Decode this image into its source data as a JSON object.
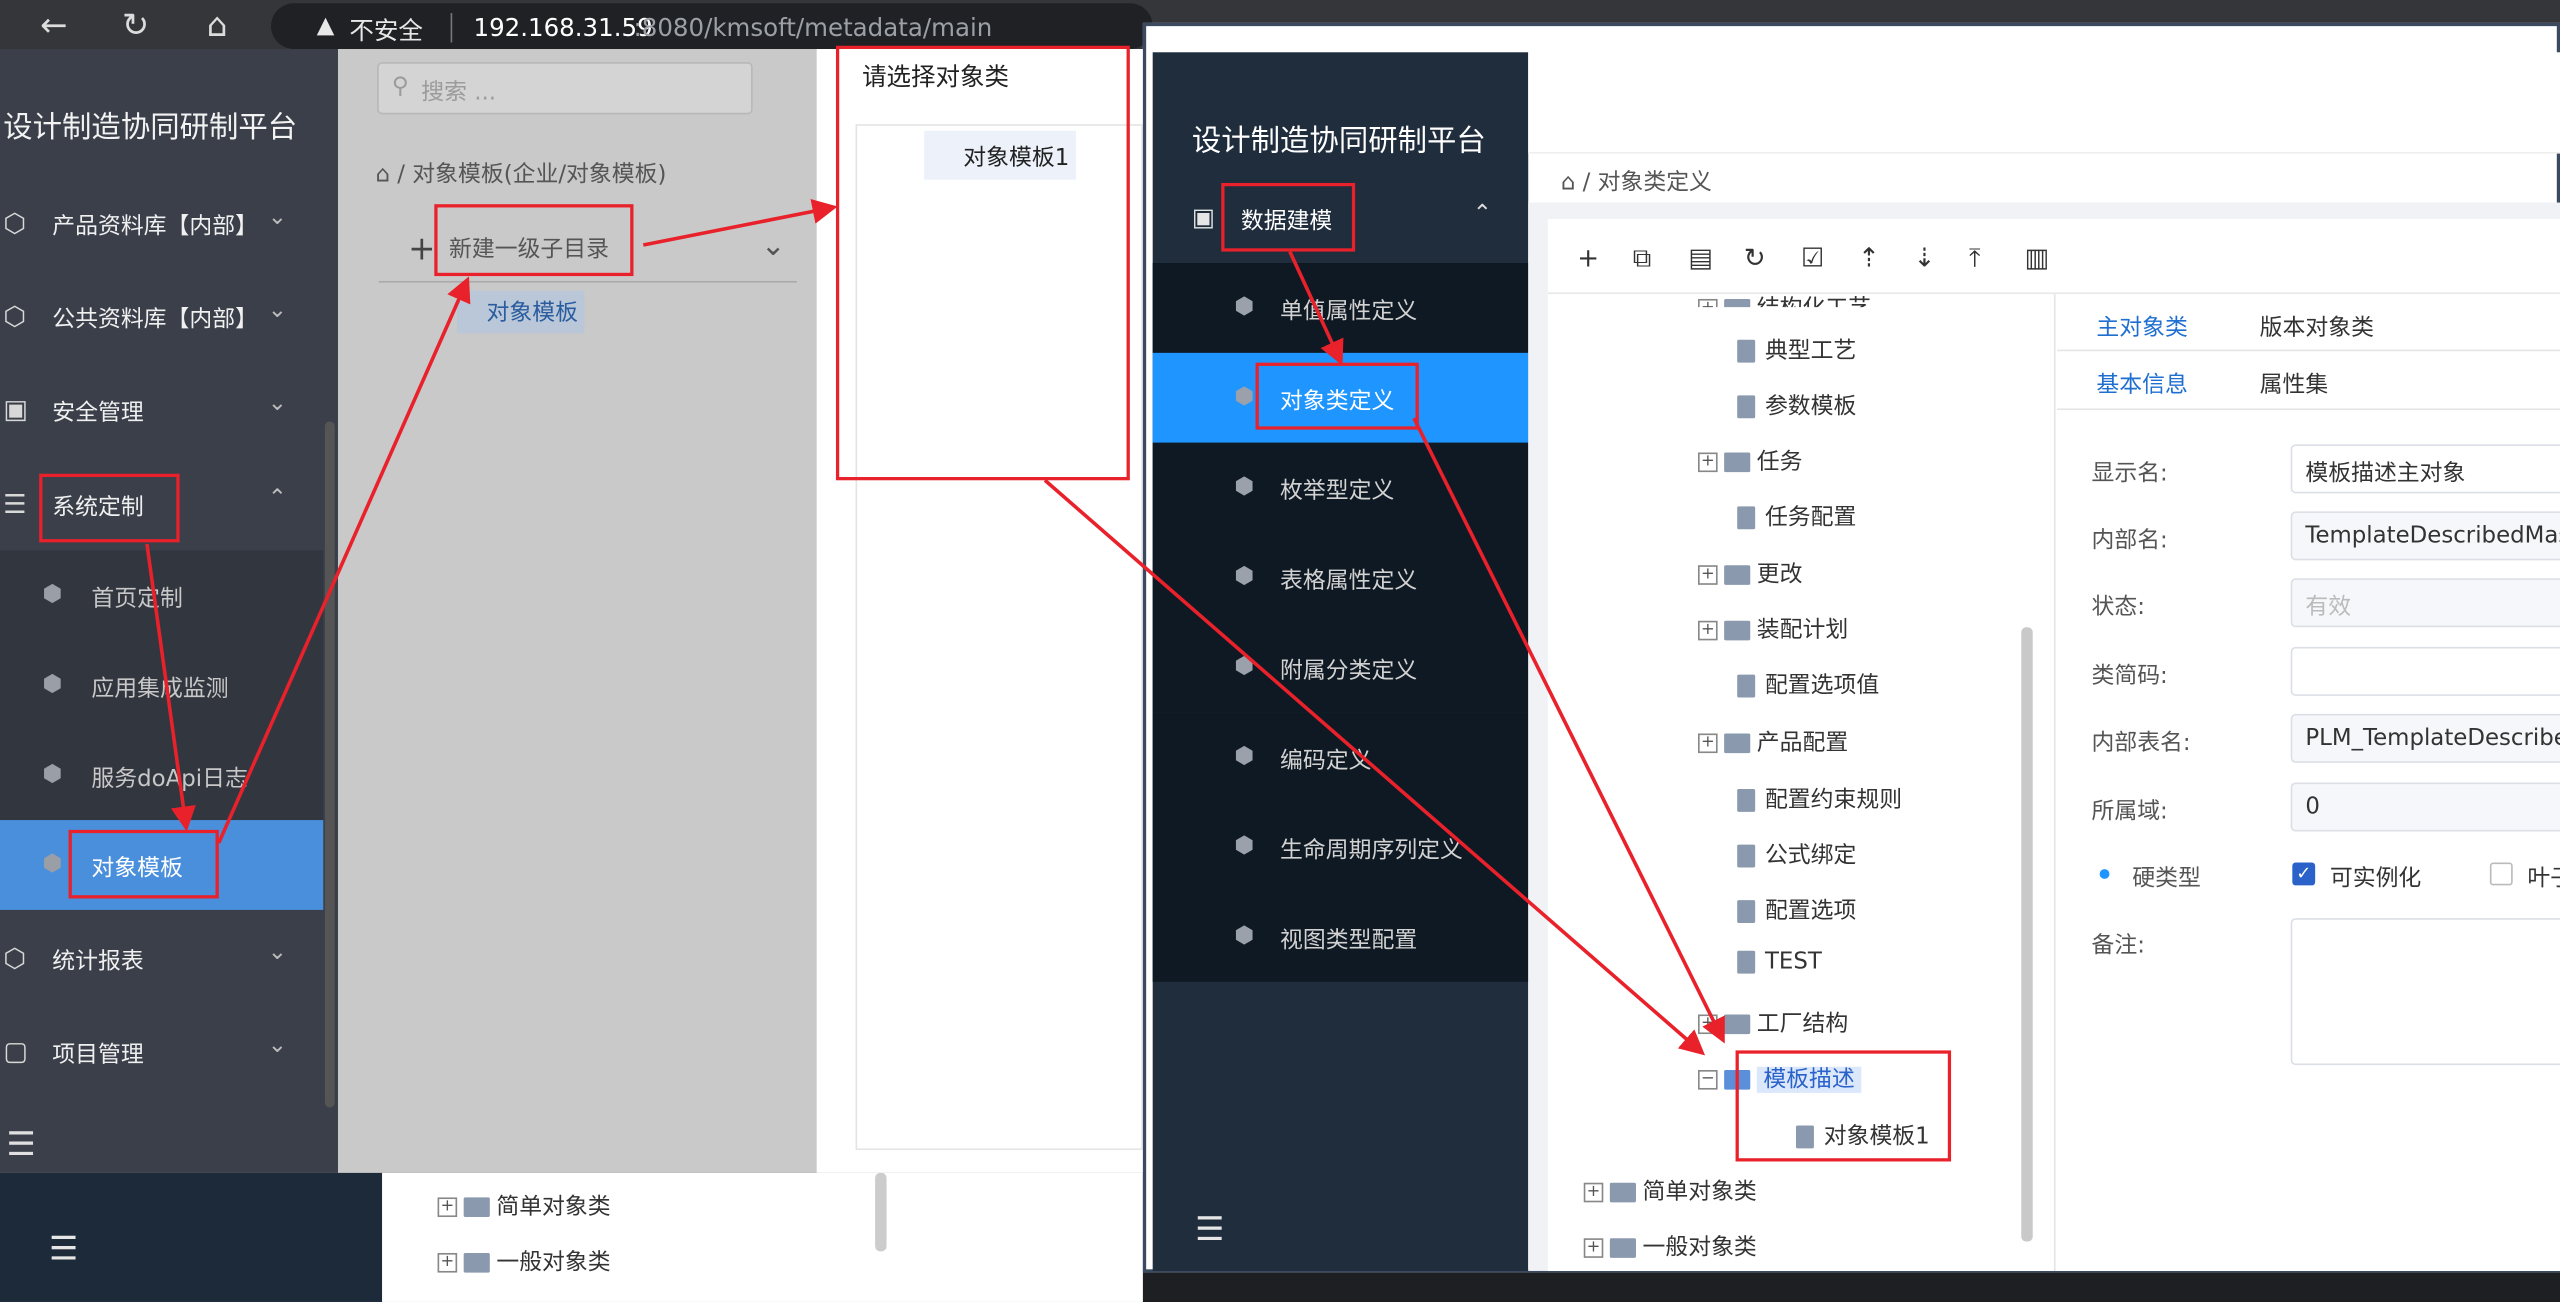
{
  "browser": {
    "warning": "不安全",
    "url_host": "192.168.31.59",
    "url_path": ":8080/kmsoft/metadata/main"
  },
  "left_app": {
    "brand": "设计制造协同研制平台",
    "menus": [
      {
        "label": "产品资料库【内部】"
      },
      {
        "label": "公共资料库【内部】"
      },
      {
        "label": "安全管理"
      },
      {
        "label": "系统定制"
      }
    ],
    "submenus": [
      {
        "label": "首页定制"
      },
      {
        "label": "应用集成监测"
      },
      {
        "label": "服务doApi日志"
      },
      {
        "label": "对象模板"
      }
    ],
    "menus_after": [
      {
        "label": "统计报表"
      },
      {
        "label": "项目管理"
      }
    ]
  },
  "middle": {
    "search_placeholder": "搜索 ...",
    "breadcrumb": "对象模板(企业/对象模板)",
    "new_dir": "新建一级子目录",
    "tree_item": "对象模板"
  },
  "picker": {
    "title": "请选择对象类",
    "node": "对象模板1"
  },
  "lower_tree": [
    {
      "label": "简单对象类"
    },
    {
      "label": "一般对象类"
    }
  ],
  "right_app": {
    "brand": "设计制造协同研制平台",
    "group": "数据建模",
    "items": [
      {
        "label": "单值属性定义"
      },
      {
        "label": "对象类定义"
      },
      {
        "label": "枚举型定义"
      },
      {
        "label": "表格属性定义"
      },
      {
        "label": "附属分类定义"
      },
      {
        "label": "编码定义"
      },
      {
        "label": "生命周期序列定义"
      },
      {
        "label": "视图类型配置"
      }
    ],
    "breadcrumb": "对象类定义",
    "tree": [
      {
        "label": "结构化工艺",
        "kind": "folder"
      },
      {
        "label": "典型工艺",
        "kind": "doc"
      },
      {
        "label": "参数模板",
        "kind": "doc"
      },
      {
        "label": "任务",
        "kind": "folder"
      },
      {
        "label": "任务配置",
        "kind": "doc"
      },
      {
        "label": "更改",
        "kind": "folder"
      },
      {
        "label": "装配计划",
        "kind": "folder"
      },
      {
        "label": "配置选项值",
        "kind": "doc"
      },
      {
        "label": "产品配置",
        "kind": "folder"
      },
      {
        "label": "配置约束规则",
        "kind": "doc"
      },
      {
        "label": "公式绑定",
        "kind": "doc"
      },
      {
        "label": "配置选项",
        "kind": "doc"
      },
      {
        "label": "TEST",
        "kind": "doc"
      },
      {
        "label": "工厂结构",
        "kind": "folder"
      },
      {
        "label": "模板描述",
        "kind": "folder-open"
      },
      {
        "label": "对象模板1",
        "kind": "doc"
      },
      {
        "label": "简单对象类",
        "kind": "folder"
      },
      {
        "label": "一般对象类",
        "kind": "folder"
      }
    ],
    "tabs_top": [
      "主对象类",
      "版本对象类"
    ],
    "tabs_sub": [
      "基本信息",
      "属性集"
    ],
    "fields": {
      "display_name_label": "显示名:",
      "display_name": "模板描述主对象",
      "internal_name_label": "内部名:",
      "internal_name": "TemplateDescribedMast",
      "status_label": "状态:",
      "status": "有效",
      "class_code_label": "类简码:",
      "class_code": "",
      "table_name_label": "内部表名:",
      "table_name": "PLM_TemplateDescribed",
      "domain_label": "所属域:",
      "domain": "0",
      "hard_type_label": "硬类型",
      "instantiable_label": "可实例化",
      "leaf_label": "叶子",
      "remark_label": "备注:"
    }
  },
  "colors": {
    "annotation": "#e8212b",
    "active_left": "#4a8fdc",
    "active_right": "#1f95ff",
    "nav_dark": "#1f2d3d"
  }
}
